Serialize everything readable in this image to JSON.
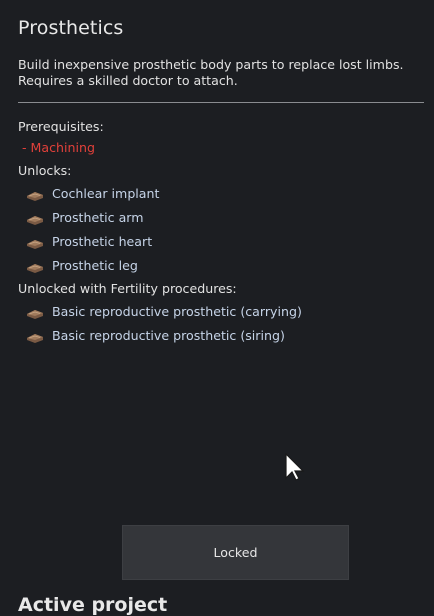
{
  "project": {
    "title": "Prosthetics",
    "description": "Build inexpensive prosthetic body parts to replace lost limbs. Requires a skilled doctor to attach."
  },
  "prerequisites": {
    "label": "Prerequisites:",
    "items": [
      {
        "label": "- Machining",
        "status": "unmet",
        "color": "#e0403a"
      }
    ]
  },
  "unlocks": {
    "label": "Unlocks:",
    "items": [
      {
        "label": "Cochlear implant",
        "icon": "prosthetic-part-icon"
      },
      {
        "label": "Prosthetic arm",
        "icon": "prosthetic-part-icon"
      },
      {
        "label": "Prosthetic heart",
        "icon": "prosthetic-part-icon"
      },
      {
        "label": "Prosthetic leg",
        "icon": "prosthetic-part-icon"
      }
    ]
  },
  "fertility_unlocks": {
    "label": "Unlocked with Fertility procedures:",
    "items": [
      {
        "label": "Basic reproductive prosthetic (carrying)",
        "icon": "prosthetic-part-icon"
      },
      {
        "label": "Basic reproductive prosthetic (siring)",
        "icon": "prosthetic-part-icon"
      }
    ]
  },
  "action": {
    "label": "Locked",
    "state": "disabled"
  },
  "active_project": {
    "title": "Active project"
  },
  "colors": {
    "background": "#1c1e22",
    "text": "#e2e2e2",
    "link": "#c6d4e8",
    "unmet": "#e0403a",
    "button": "#34363a"
  }
}
